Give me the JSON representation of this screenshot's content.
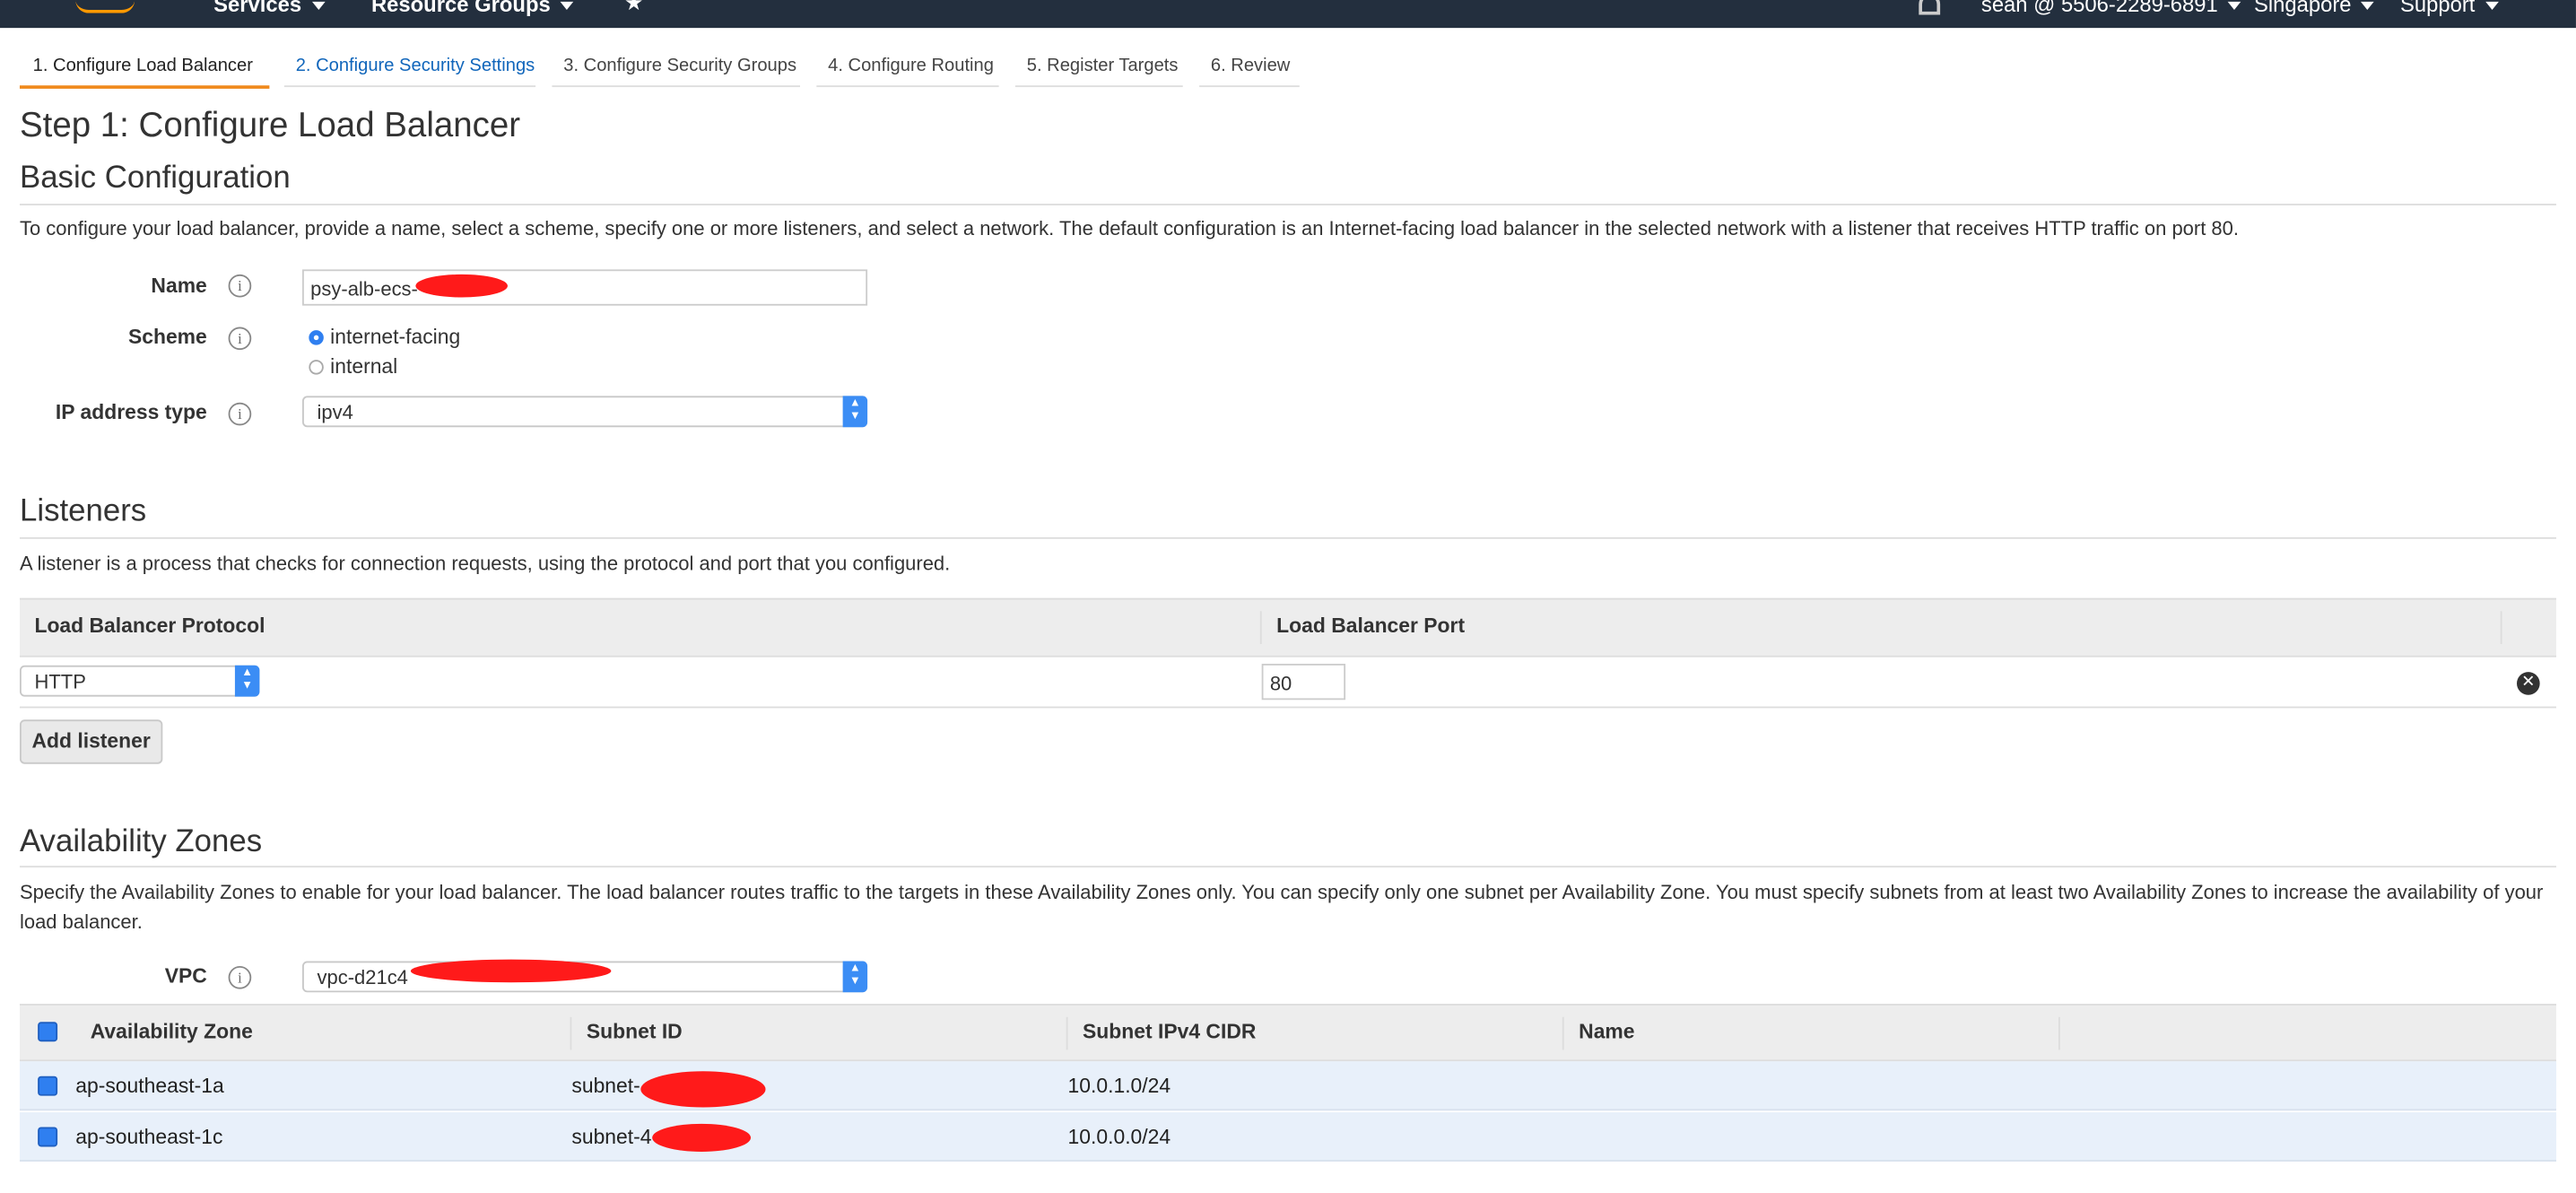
{
  "nav": {
    "services": "Services",
    "resource_groups": "Resource Groups",
    "account": "sean @ 5506-2289-6891",
    "region": "Singapore",
    "support": "Support"
  },
  "tabs": [
    {
      "label": "1. Configure Load Balancer",
      "state": "active"
    },
    {
      "label": "2. Configure Security Settings",
      "state": "link"
    },
    {
      "label": "3. Configure Security Groups",
      "state": "normal"
    },
    {
      "label": "4. Configure Routing",
      "state": "normal"
    },
    {
      "label": "5. Register Targets",
      "state": "normal"
    },
    {
      "label": "6. Review",
      "state": "normal"
    }
  ],
  "page_title": "Step 1: Configure Load Balancer",
  "basic": {
    "heading": "Basic Configuration",
    "description": "To configure your load balancer, provide a name, select a scheme, specify one or more listeners, and select a network. The default configuration is an Internet-facing load balancer in the selected network with a listener that receives HTTP traffic on port 80.",
    "name_label": "Name",
    "name_value": "psy-alb-ecs-",
    "scheme_label": "Scheme",
    "scheme_options": [
      "internet-facing",
      "internal"
    ],
    "scheme_selected": "internet-facing",
    "ip_label": "IP address type",
    "ip_value": "ipv4"
  },
  "listeners": {
    "heading": "Listeners",
    "description": "A listener is a process that checks for connection requests, using the protocol and port that you configured.",
    "col_protocol": "Load Balancer Protocol",
    "col_port": "Load Balancer Port",
    "rows": [
      {
        "protocol": "HTTP",
        "port": "80"
      }
    ],
    "add_button": "Add listener"
  },
  "az": {
    "heading": "Availability Zones",
    "description": "Specify the Availability Zones to enable for your load balancer. The load balancer routes traffic to the targets in these Availability Zones only. You can specify only one subnet per Availability Zone. You must specify subnets from at least two Availability Zones to increase the availability of your load balancer.",
    "vpc_label": "VPC",
    "vpc_value": "vpc-d21c4",
    "columns": [
      "Availability Zone",
      "Subnet ID",
      "Subnet IPv4 CIDR",
      "Name"
    ],
    "rows": [
      {
        "zone": "ap-southeast-1a",
        "subnet": "subnet-",
        "cidr": "10.0.1.0/24",
        "name": ""
      },
      {
        "zone": "ap-southeast-1c",
        "subnet": "subnet-4",
        "cidr": "10.0.0.0/24",
        "name": ""
      }
    ]
  },
  "colors": {
    "nav_bg": "#232f3e",
    "active_tab_underline": "#f08a1c",
    "link_blue": "#1166bb",
    "selected_row_bg": "#e8f0fa",
    "redaction": "#ff1a1a"
  }
}
